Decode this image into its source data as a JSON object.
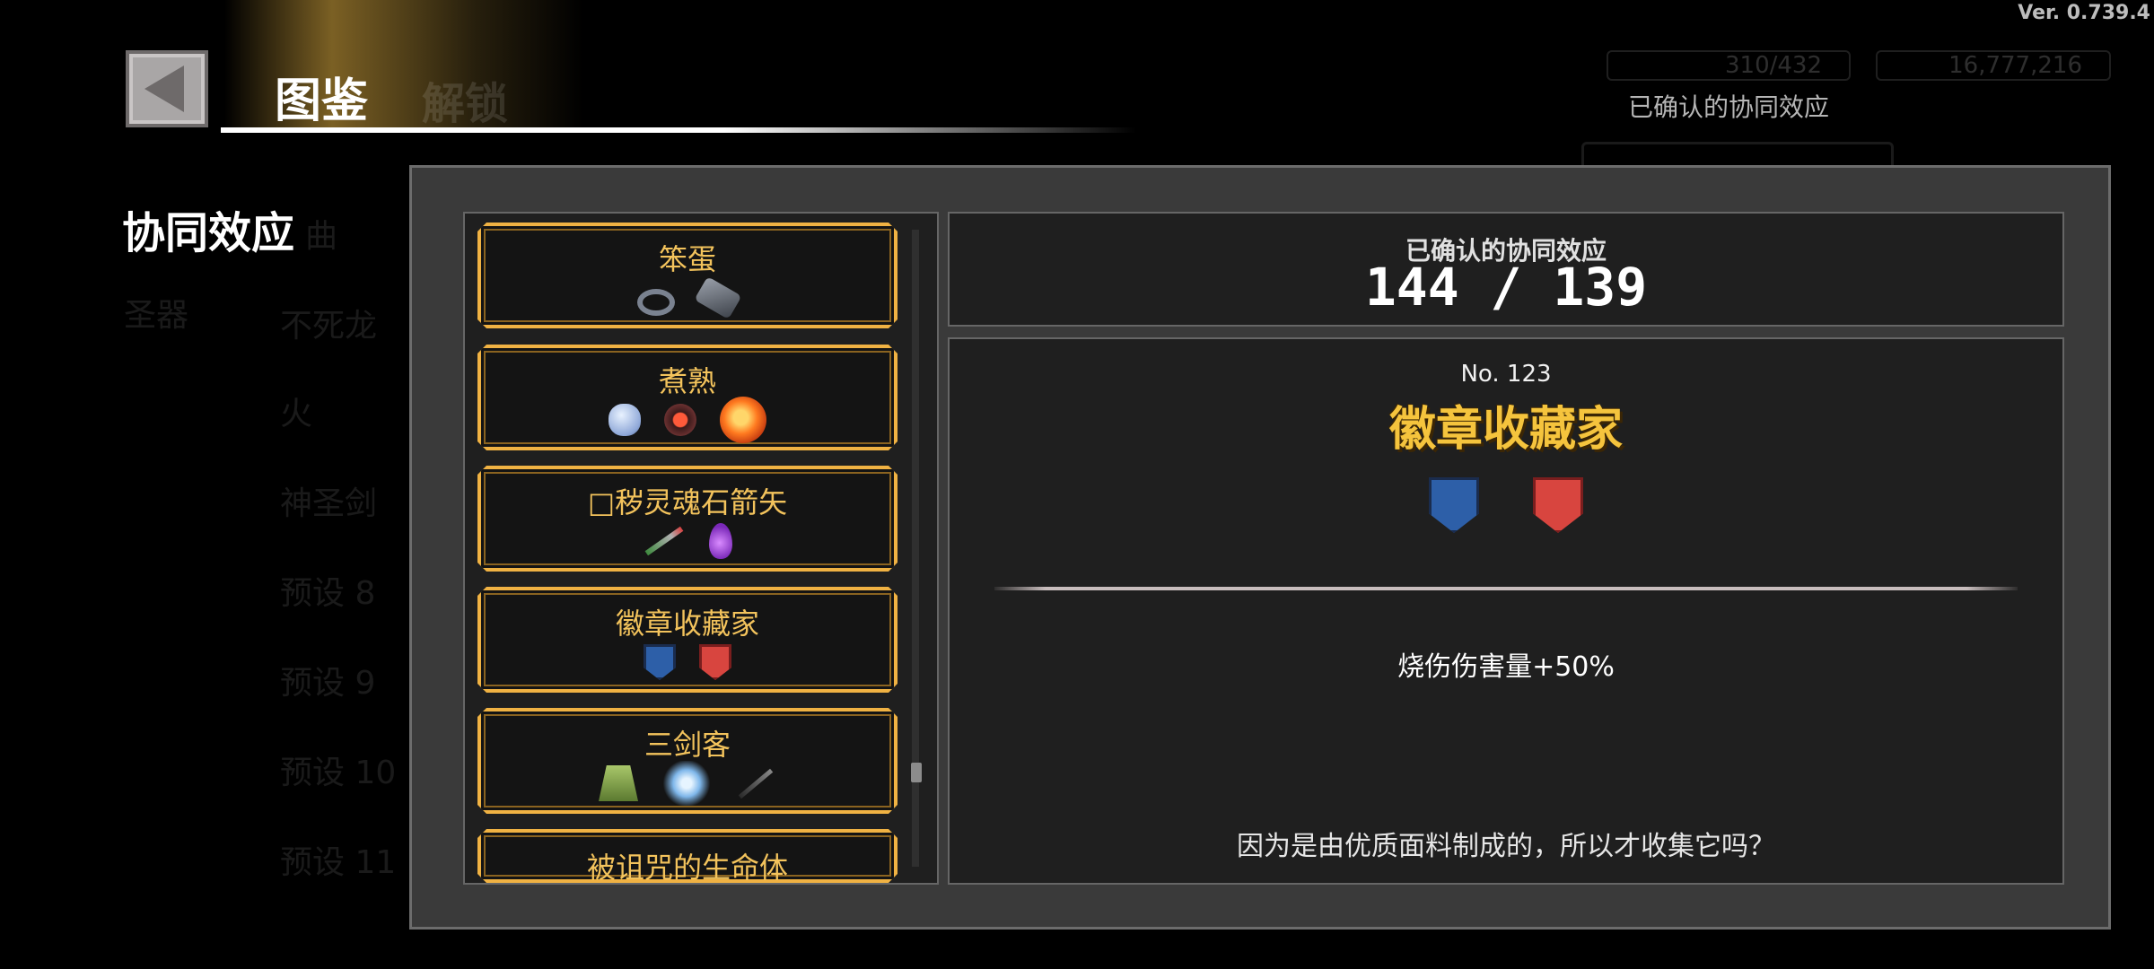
{
  "app": {
    "version": "Ver. 0.739.4",
    "title": "图鉴",
    "ghost_tab": "解锁"
  },
  "top_right": {
    "stat1": "310/432",
    "stat2": "16,777,216",
    "confirmed_label": "已确认的协同效应"
  },
  "nav": {
    "active": "协同效应",
    "items": [
      "圣器",
      "曲",
      "不死龙",
      "火",
      "神圣剑",
      "预设 8",
      "预设 9",
      "预设 10",
      "预设 11"
    ]
  },
  "list": {
    "cards": [
      {
        "title": "笨蛋",
        "icons": [
          "ring-icon",
          "gauntlet-icon"
        ]
      },
      {
        "title": "煮熟",
        "icons": [
          "apple-icon",
          "potion-icon",
          "fireball-icon"
        ]
      },
      {
        "title": "□秽灵魂石箭矢",
        "icons": [
          "arrow-icon",
          "soul-gem-icon"
        ]
      },
      {
        "title": "徽章收藏家",
        "icons": [
          "blue-crest-icon",
          "red-crest-icon"
        ]
      },
      {
        "title": "三剑客",
        "icons": [
          "cloak-icon",
          "ice-blade-icon",
          "dagger-icon"
        ]
      },
      {
        "title": "被诅咒的生命体",
        "icons": []
      }
    ]
  },
  "summary": {
    "label": "已确认的协同效应",
    "value": "144 / 139"
  },
  "detail": {
    "number": "No. 123",
    "name": "徽章收藏家",
    "icons": [
      "blue-crest-icon",
      "red-crest-icon"
    ],
    "effect": "烧伤伤害量+50%",
    "flavor": "因为是由优质面料制成的，所以才收集它吗？"
  },
  "colors": {
    "card_border": "#f0b243",
    "card_title": "#f3c35c",
    "detail_title": "#f5c43d",
    "panel_bg": "#3a3a3a"
  }
}
